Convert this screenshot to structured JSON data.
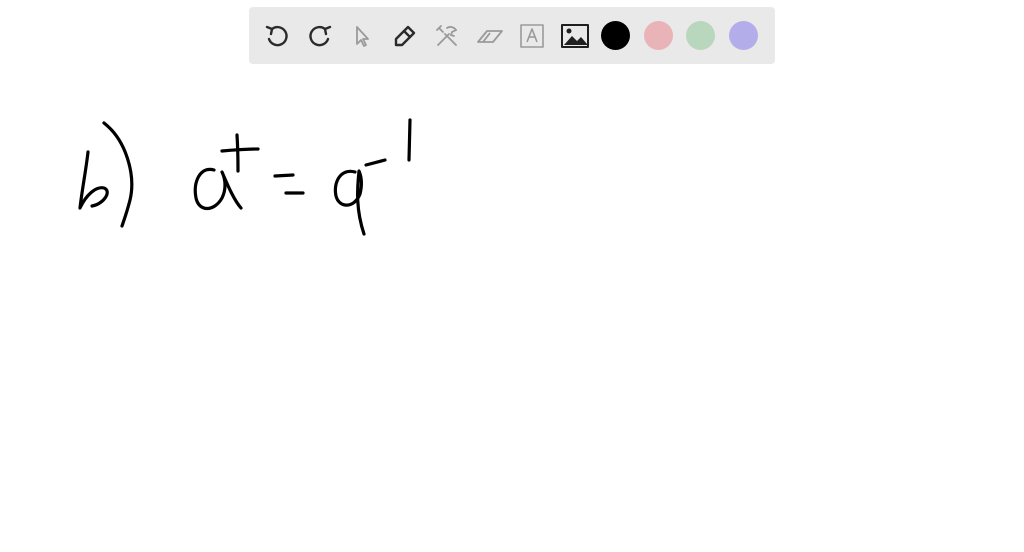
{
  "toolbar": {
    "tools": [
      {
        "icon": "undo-icon",
        "enabled": true
      },
      {
        "icon": "redo-icon",
        "enabled": true
      },
      {
        "icon": "pointer-icon",
        "enabled": false
      },
      {
        "icon": "pen-icon",
        "enabled": true
      },
      {
        "icon": "tools-icon",
        "enabled": false
      },
      {
        "icon": "eraser-icon",
        "enabled": false
      },
      {
        "icon": "text-icon",
        "enabled": false
      },
      {
        "icon": "image-icon",
        "enabled": true
      }
    ],
    "colors": {
      "black": "#000000",
      "red": "#e8b4b8",
      "green": "#b9d7bc",
      "purple": "#b3aeea"
    },
    "selected_color": "black"
  },
  "canvas": {
    "handwritten_expression": "b) a† = a⁻¹"
  }
}
